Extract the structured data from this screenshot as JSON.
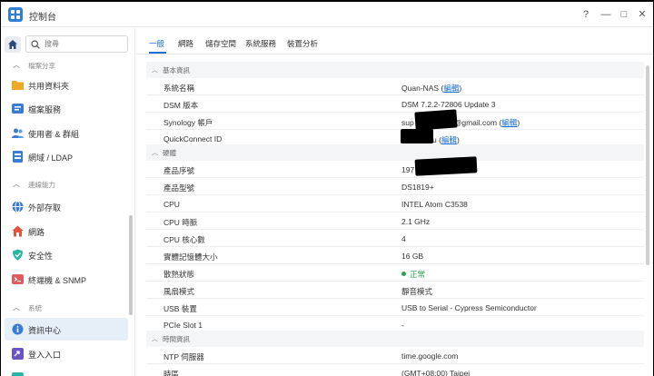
{
  "titlebar": {
    "title": "控制台",
    "help": "?",
    "minimize": "—",
    "maximize": "□",
    "close": "✕"
  },
  "sidebar": {
    "search_placeholder": "搜尋",
    "sections": [
      {
        "label": "檔案分享"
      },
      {
        "label": "連線能力"
      },
      {
        "label": "系統"
      }
    ],
    "items": [
      {
        "label": "共用資料夾",
        "color": "#f0a824"
      },
      {
        "label": "檔案服務",
        "color": "#3a7bd5"
      },
      {
        "label": "使用者 & 群組",
        "color": "#3a7bd5"
      },
      {
        "label": "網域 / LDAP",
        "color": "#3a7bd5"
      },
      {
        "label": "外部存取",
        "color": "#3a7bd5"
      },
      {
        "label": "網路",
        "color": "#e5533d"
      },
      {
        "label": "安全性",
        "color": "#2bb3a3"
      },
      {
        "label": "終端機 & SNMP",
        "color": "#e05b5b"
      },
      {
        "label": "資訊中心",
        "color": "#3a7bd5"
      },
      {
        "label": "登入入口",
        "color": "#6b52c7"
      }
    ]
  },
  "tabs": [
    "一般",
    "網路",
    "儲存空間",
    "系統服務",
    "裝置分析"
  ],
  "groups": {
    "basic": "基本資訊",
    "hardware": "硬體",
    "time": "時間資訊"
  },
  "basic_rows": [
    {
      "key": "系統名稱",
      "value": "Quan-NAS",
      "link": "編輯"
    },
    {
      "key": "DSM 版本",
      "value": "DSM 7.2.2-72806 Update 3"
    },
    {
      "key": "Synology 帳戶",
      "value": "sup",
      "value2": "@gmail.com",
      "link": "編輯"
    },
    {
      "key": "QuickConnect ID",
      "value": "u",
      "link": "編輯"
    }
  ],
  "hardware_rows": [
    {
      "key": "產品序號",
      "value": "197"
    },
    {
      "key": "產品型號",
      "value": "DS1819+"
    },
    {
      "key": "CPU",
      "value": "INTEL Atom C3538"
    },
    {
      "key": "CPU 時脈",
      "value": "2.1 GHz"
    },
    {
      "key": "CPU 核心數",
      "value": "4"
    },
    {
      "key": "實體記憶體大小",
      "value": "16 GB"
    },
    {
      "key": "散熱狀態",
      "value": "正常",
      "status_color": "#2da44e"
    },
    {
      "key": "風扇模式",
      "value": "靜音模式"
    },
    {
      "key": "USB 裝置",
      "value": "USB to Serial - Cypress Semiconductor"
    },
    {
      "key": "PCIe Slot 1",
      "value": "-"
    }
  ],
  "time_rows": [
    {
      "key": "NTP 伺服器",
      "value": "time.google.com"
    },
    {
      "key": "時區",
      "value": "(GMT+08:00) Taipei"
    }
  ]
}
